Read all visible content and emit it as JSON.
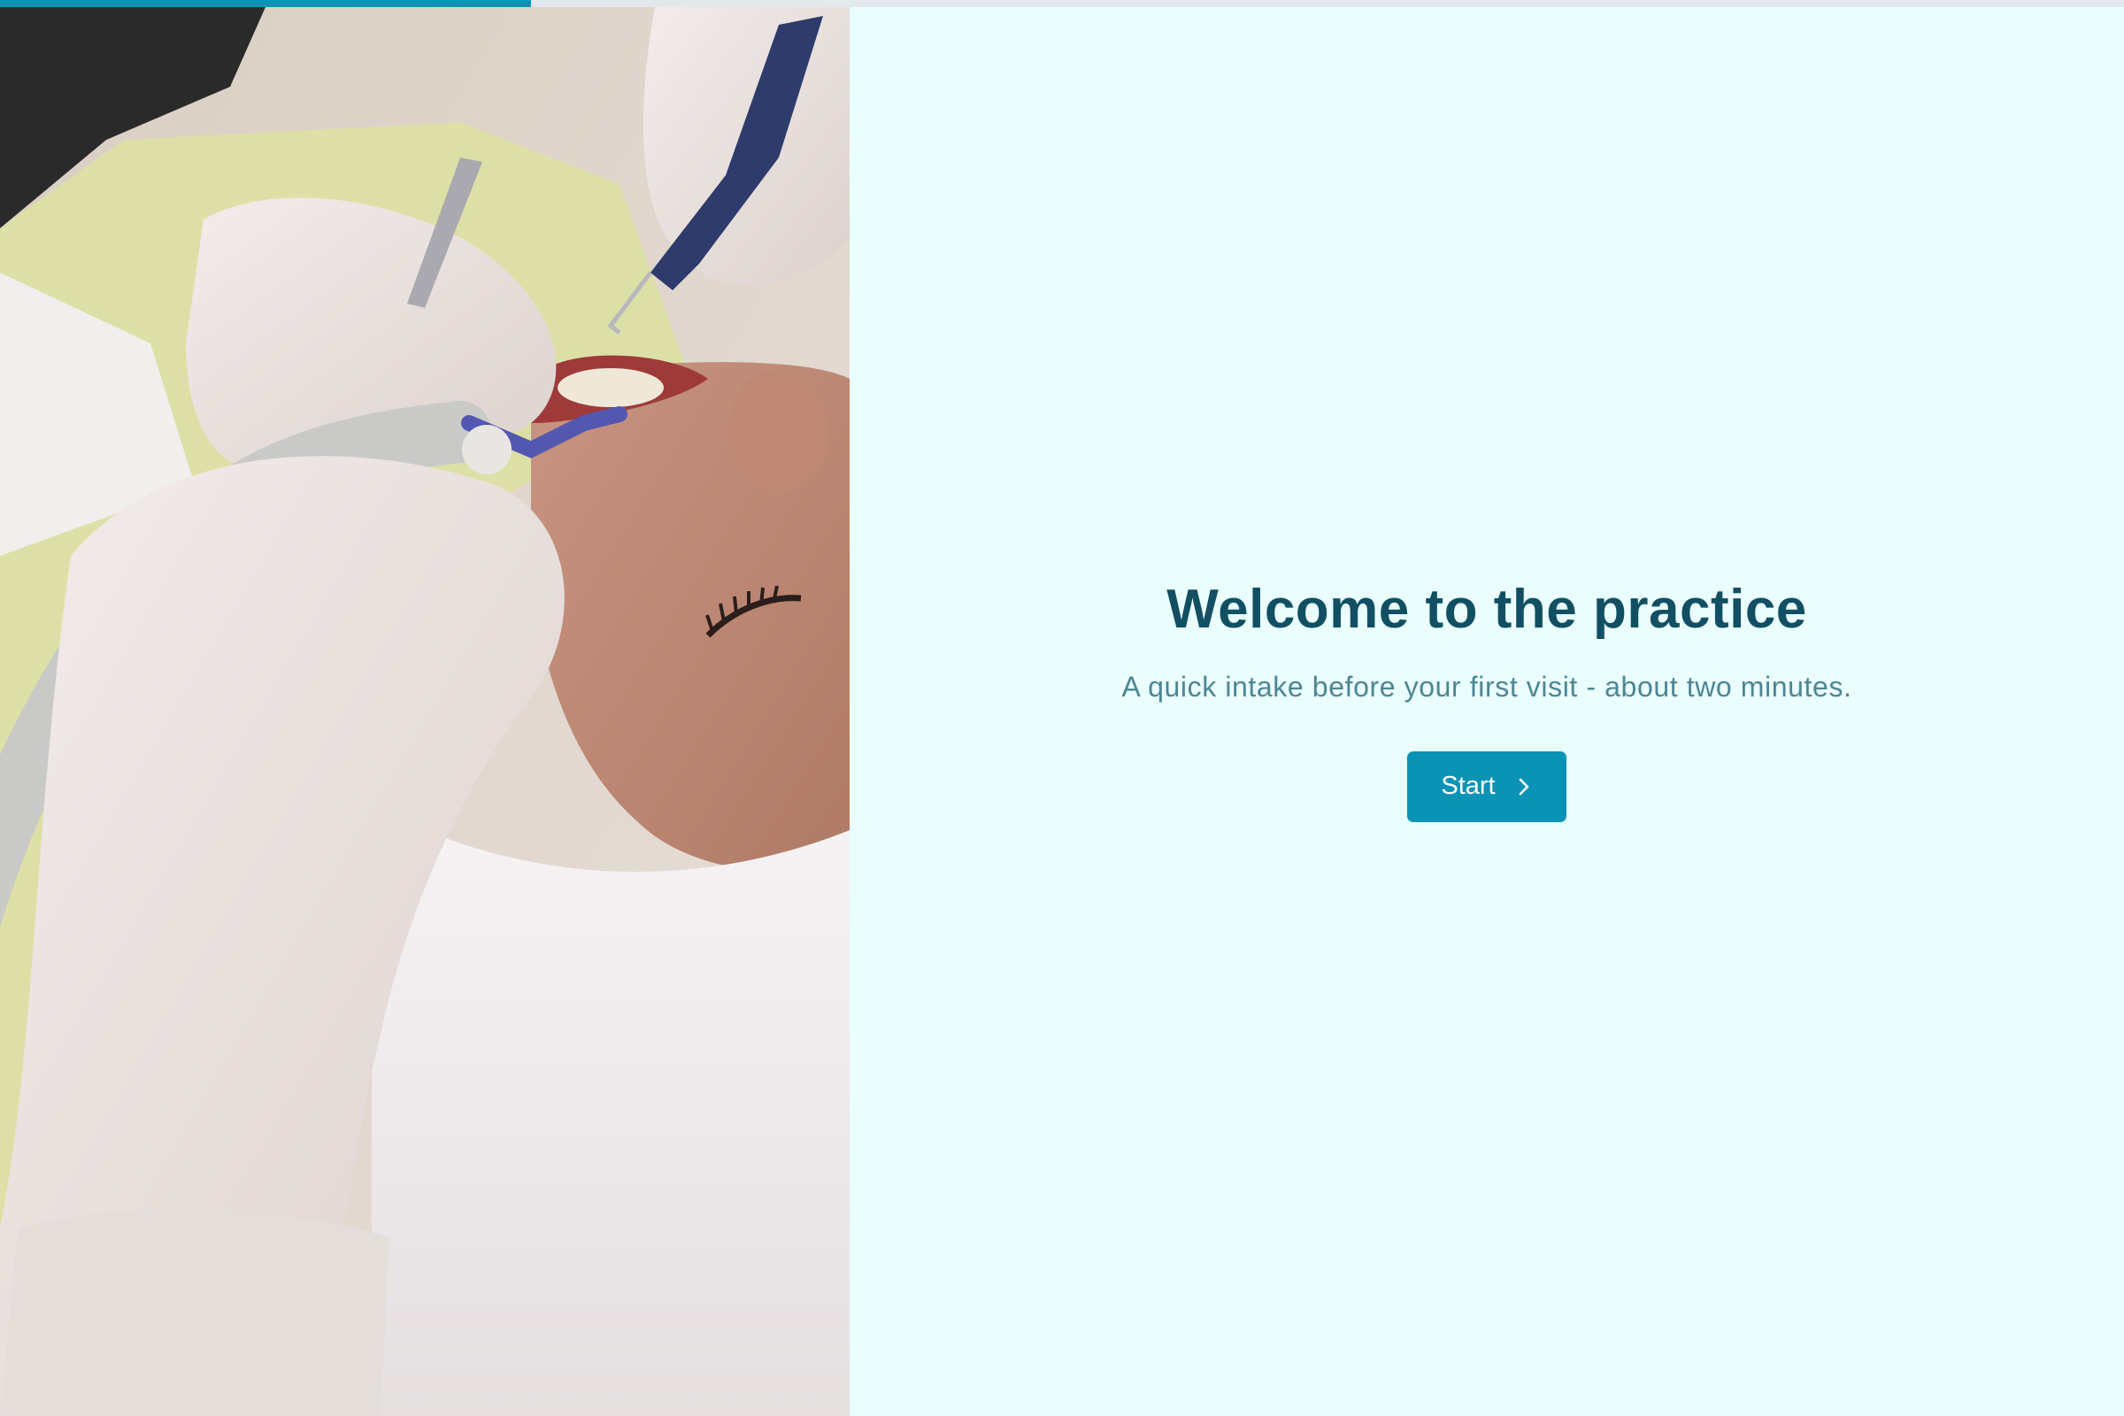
{
  "progress": {
    "fraction": 0.25,
    "color": "#0A93B4",
    "track_color": "#E2E8EC"
  },
  "hero_image": {
    "subject": "dentist examining patient"
  },
  "welcome": {
    "title": "Welcome to the practice",
    "subtitle": "A quick intake before your first visit - about two minutes.",
    "start_label": "Start",
    "start_icon": "chevron-right-icon"
  },
  "colors": {
    "background": "#E9FEFD",
    "title": "#124F63",
    "subtitle": "#4E8594",
    "button": "#0A93B4",
    "button_text": "#FFFFFF"
  }
}
